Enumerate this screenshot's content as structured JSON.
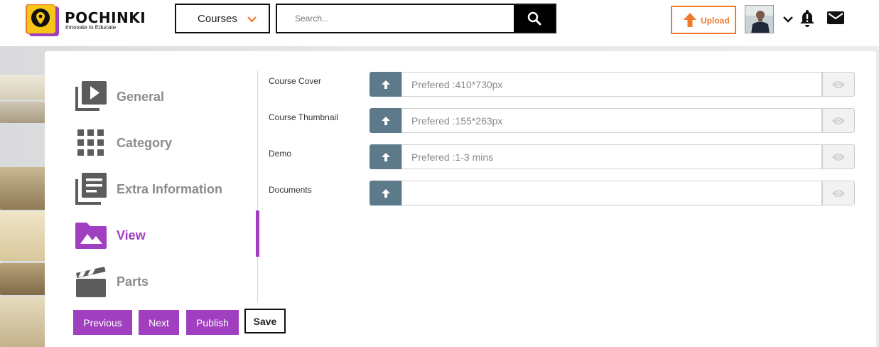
{
  "brand": {
    "name": "POCHINKI",
    "tagline": "Innovate to Educate",
    "accent": "#a040c0",
    "upload_color": "#f07a2c"
  },
  "header": {
    "courses_dropdown": {
      "label": "Courses",
      "icon": "chevron-down-icon"
    },
    "search": {
      "placeholder": "Search...",
      "value": "",
      "icon": "search-icon"
    },
    "upload": {
      "label": "Upload",
      "icon": "arrow-up-icon"
    },
    "icons": [
      "avatar",
      "chevron-down-icon",
      "bell-alert-icon",
      "mail-icon"
    ]
  },
  "steps": [
    {
      "label": "General",
      "icon": "video-library-icon",
      "active": false
    },
    {
      "label": "Category",
      "icon": "grid-icon",
      "active": false
    },
    {
      "label": "Extra Information",
      "icon": "article-list-icon",
      "active": false
    },
    {
      "label": "View",
      "icon": "image-folder-icon",
      "active": true
    },
    {
      "label": "Parts",
      "icon": "clapperboard-icon",
      "active": false
    }
  ],
  "fields": [
    {
      "label": "Course Cover",
      "placeholder": "Prefered :410*730px",
      "value": ""
    },
    {
      "label": "Course Thumbnail",
      "placeholder": "Prefered :155*263px",
      "value": ""
    },
    {
      "label": "Demo",
      "placeholder": "Prefered :1-3 mins",
      "value": ""
    },
    {
      "label": "Documents",
      "placeholder": "",
      "value": ""
    }
  ],
  "actions": {
    "previous": "Previous",
    "next": "Next",
    "publish": "Publish",
    "save": "Save"
  }
}
